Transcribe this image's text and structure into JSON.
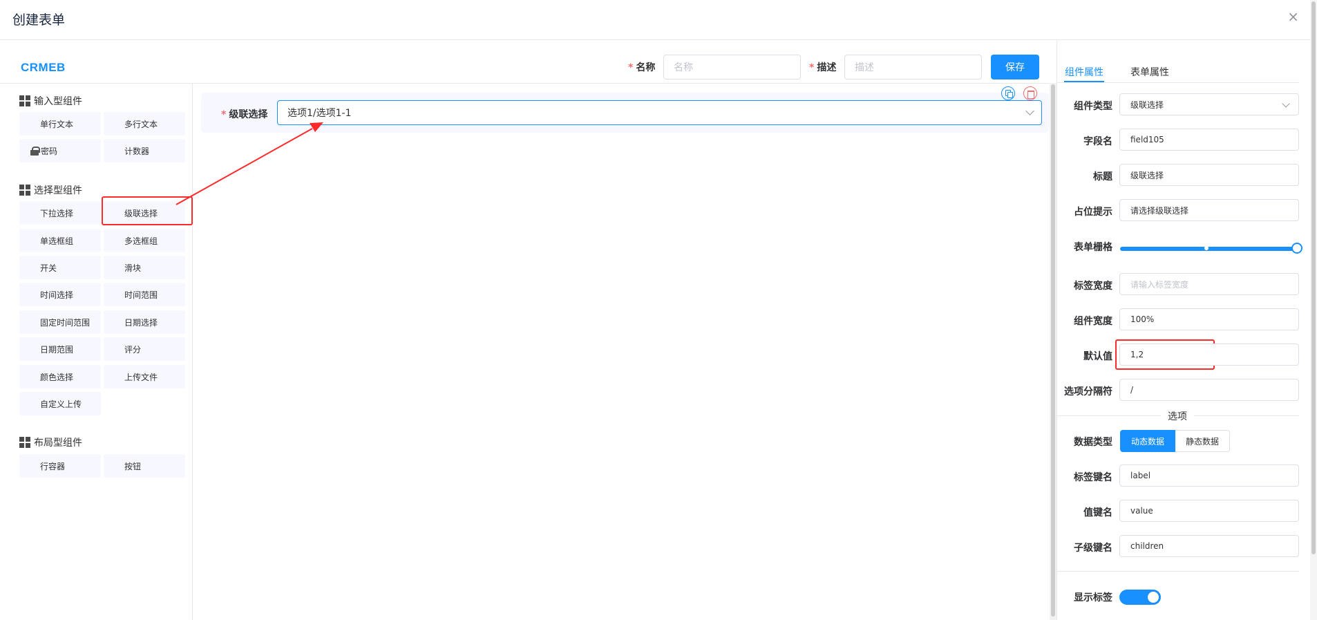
{
  "dialog": {
    "title": "创建表单",
    "close_glyph": "×"
  },
  "logo": "CRMEB",
  "header": {
    "required_mark": "*",
    "name_label": "名称",
    "name_placeholder": "名称",
    "desc_label": "描述",
    "desc_placeholder": "描述",
    "save_label": "保存"
  },
  "groups": [
    {
      "title": "输入型组件",
      "items": [
        "单行文本",
        "多行文本",
        "密码",
        "计数器"
      ]
    },
    {
      "title": "选择型组件",
      "items": [
        "下拉选择",
        "级联选择",
        "单选框组",
        "多选框组",
        "开关",
        "滑块",
        "时间选择",
        "时间范围",
        "固定时间范围",
        "日期选择",
        "日期范围",
        "评分",
        "颜色选择",
        "上传文件",
        "自定义上传"
      ]
    },
    {
      "title": "布局型组件",
      "items": [
        "行容器",
        "按钮"
      ]
    }
  ],
  "canvas": {
    "field_label": "级联选择",
    "field_value": "选项1/选项1-1"
  },
  "tabs": [
    "组件属性",
    "表单属性"
  ],
  "props": {
    "component_type": {
      "label": "组件类型",
      "value": "级联选择"
    },
    "field_name": {
      "label": "字段名",
      "value": "field105"
    },
    "title": {
      "label": "标题",
      "value": "级联选择"
    },
    "placeholder": {
      "label": "占位提示",
      "value": "请选择级联选择"
    },
    "grid": {
      "label": "表单栅格",
      "value": 24,
      "max": 24
    },
    "label_width": {
      "label": "标签宽度",
      "placeholder": "请输入标签宽度"
    },
    "component_width": {
      "label": "组件宽度",
      "value": "100%"
    },
    "default_value": {
      "label": "默认值",
      "value": "1,2"
    },
    "separator": {
      "label": "选项分隔符",
      "value": "/"
    },
    "options_section": "选项",
    "data_type": {
      "label": "数据类型",
      "options": [
        "动态数据",
        "静态数据"
      ],
      "selected": "动态数据"
    },
    "label_key": {
      "label": "标签键名",
      "value": "label"
    },
    "value_key": {
      "label": "值键名",
      "value": "value"
    },
    "children_key": {
      "label": "子级键名",
      "value": "children"
    },
    "show_label": {
      "label": "显示标签",
      "on": true
    }
  },
  "colors": {
    "accent": "#1890ff",
    "annotation": "#ff2a2a",
    "required": "#f56c6c"
  }
}
